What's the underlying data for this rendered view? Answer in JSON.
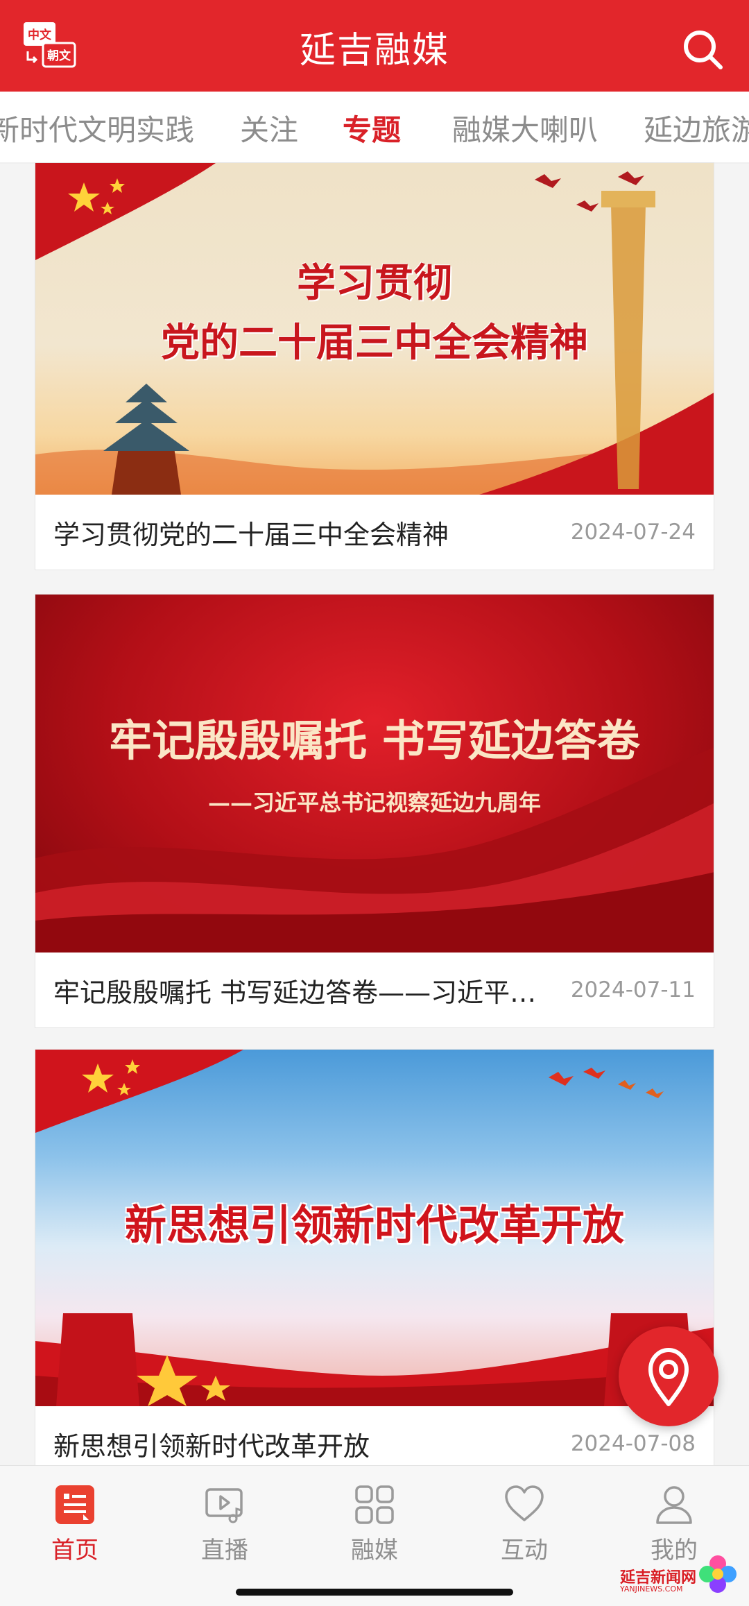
{
  "header": {
    "title": "延吉融媒",
    "lang_icon_top": "中文",
    "lang_icon_bottom": "朝文"
  },
  "tabs": [
    {
      "label": "新时代文明实践"
    },
    {
      "label": "关注"
    },
    {
      "label": "专题",
      "active": true
    },
    {
      "label": "融媒大喇叭"
    },
    {
      "label": "延边旅游"
    }
  ],
  "cards": [
    {
      "banner_line1": "学习贯彻",
      "banner_line2": "党的二十届三中全会精神",
      "title": "学习贯彻党的二十届三中全会精神",
      "date": "2024-07-24"
    },
    {
      "banner_line1": "牢记殷殷嘱托 书写延边答卷",
      "banner_line2": "——习近平总书记视察延边九周年",
      "title": "牢记殷殷嘱托 书写延边答卷——习近平总书记视察延边九周年",
      "date": "2024-07-11"
    },
    {
      "banner_line1": "新思想引领新时代改革开放",
      "title": "新思想引领新时代改革开放",
      "date": "2024-07-08"
    }
  ],
  "bottom_nav": [
    {
      "label": "首页",
      "icon": "news-icon",
      "active": true
    },
    {
      "label": "直播",
      "icon": "live-video-icon"
    },
    {
      "label": "融媒",
      "icon": "grid-icon"
    },
    {
      "label": "互动",
      "icon": "heart-icon"
    },
    {
      "label": "我的",
      "icon": "user-icon"
    }
  ],
  "watermark": {
    "text": "延吉新闻网",
    "sub": "YANJINEWS.COM"
  },
  "colors": {
    "brand_red": "#e2262b",
    "active_red": "#d92128",
    "muted_gray": "#8f8f8f"
  }
}
